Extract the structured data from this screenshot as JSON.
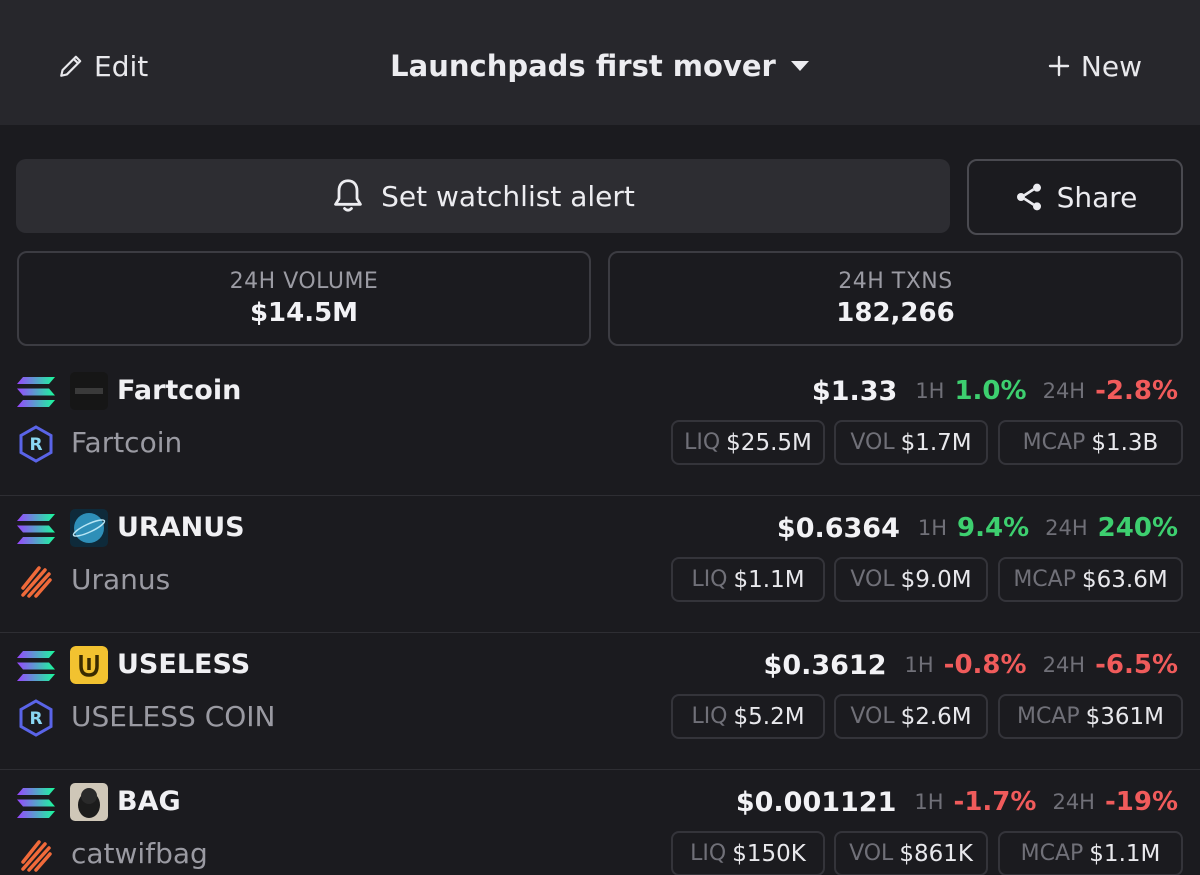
{
  "header": {
    "edit_label": "Edit",
    "title": "Launchpads first mover",
    "new_label": "New"
  },
  "actions": {
    "alert_label": "Set watchlist alert",
    "share_label": "Share"
  },
  "stats": {
    "volume_label": "24H VOLUME",
    "volume_value": "$14.5M",
    "txns_label": "24H TXNS",
    "txns_value": "182,266"
  },
  "labels": {
    "h1": "1H",
    "h24": "24H",
    "liq": "LIQ",
    "vol": "VOL",
    "mcap": "MCAP"
  },
  "colors": {
    "positive": "#3dcf6f",
    "negative": "#f05b5b",
    "background": "#1b1b1f",
    "topbar": "#27272c"
  },
  "tokens": [
    {
      "symbol": "Fartcoin",
      "name": "Fartcoin",
      "chain_icon": "solana-icon",
      "dex_icon": "raydium-icon",
      "price": "$1.33",
      "change_1h": "1.0%",
      "change_1h_dir": "pos",
      "change_24h": "-2.8%",
      "change_24h_dir": "neg",
      "liq": "$25.5M",
      "vol": "$1.7M",
      "mcap": "$1.3B"
    },
    {
      "symbol": "URANUS",
      "name": "Uranus",
      "chain_icon": "solana-icon",
      "dex_icon": "pumpfun-icon",
      "price": "$0.6364",
      "change_1h": "9.4%",
      "change_1h_dir": "pos",
      "change_24h": "240%",
      "change_24h_dir": "pos",
      "liq": "$1.1M",
      "vol": "$9.0M",
      "mcap": "$63.6M"
    },
    {
      "symbol": "USELESS",
      "name": "USELESS COIN",
      "chain_icon": "solana-icon",
      "dex_icon": "raydium-icon",
      "price": "$0.3612",
      "change_1h": "-0.8%",
      "change_1h_dir": "neg",
      "change_24h": "-6.5%",
      "change_24h_dir": "neg",
      "liq": "$5.2M",
      "vol": "$2.6M",
      "mcap": "$361M"
    },
    {
      "symbol": "BAG",
      "name": "catwifbag",
      "chain_icon": "solana-icon",
      "dex_icon": "pumpfun-icon",
      "price": "$0.001121",
      "change_1h": "-1.7%",
      "change_1h_dir": "neg",
      "change_24h": "-19%",
      "change_24h_dir": "neg",
      "liq": "$150K",
      "vol": "$861K",
      "mcap": "$1.1M"
    }
  ]
}
